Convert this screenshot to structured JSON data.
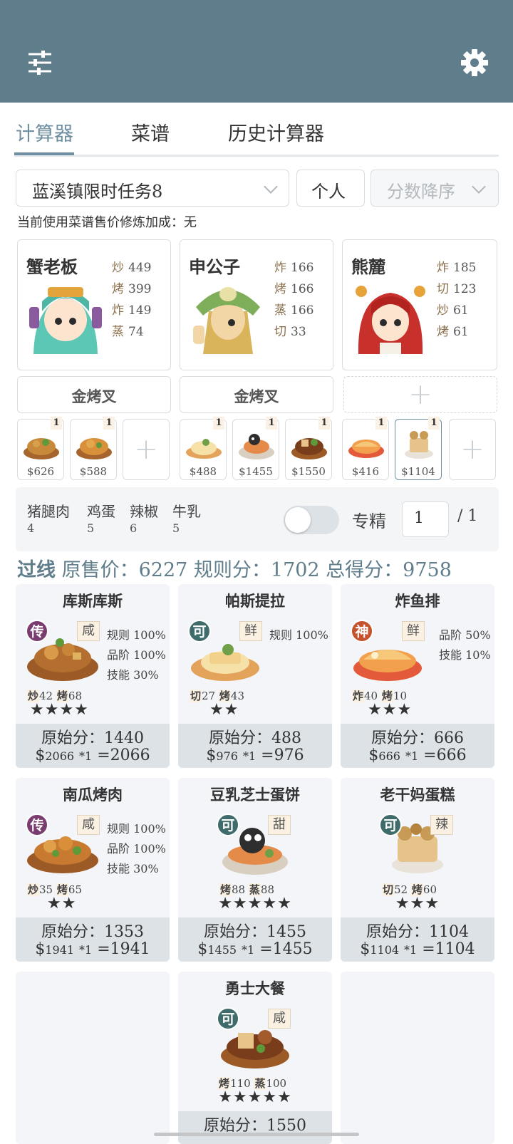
{
  "tabs": [
    "计算器",
    "菜谱",
    "历史计算器"
  ],
  "controls": {
    "task_select": "蓝溪镇限时任务8",
    "personal_button": "个人",
    "sort_select": "分数降序"
  },
  "bonus_note": "当前使用菜谱售价修炼加成：无",
  "chefs": [
    {
      "name": "蟹老板",
      "skills": [
        {
          "k": "炒",
          "v": "449"
        },
        {
          "k": "烤",
          "v": "399"
        },
        {
          "k": "炸",
          "v": "149"
        },
        {
          "k": "蒸",
          "v": "74"
        }
      ]
    },
    {
      "name": "申公子",
      "skills": [
        {
          "k": "炸",
          "v": "166"
        },
        {
          "k": "烤",
          "v": "166"
        },
        {
          "k": "蒸",
          "v": "166"
        },
        {
          "k": "切",
          "v": "33"
        }
      ]
    },
    {
      "name": "熊麓",
      "skills": [
        {
          "k": "炸",
          "v": "185"
        },
        {
          "k": "切",
          "v": "123"
        },
        {
          "k": "炒",
          "v": "61"
        },
        {
          "k": "烤",
          "v": "61"
        }
      ]
    }
  ],
  "equips": [
    "金烤叉",
    "金烤叉"
  ],
  "mini_dishes": [
    {
      "qty": "1",
      "price": "$626"
    },
    {
      "qty": "1",
      "price": "$588"
    },
    {
      "qty": "1",
      "price": "$488"
    },
    {
      "qty": "1",
      "price": "$1455"
    },
    {
      "qty": "1",
      "price": "$1550"
    },
    {
      "qty": "1",
      "price": "$416"
    },
    {
      "qty": "1",
      "price": "$1104"
    }
  ],
  "ingredients": [
    {
      "name": "猪腿肉",
      "count": "4"
    },
    {
      "name": "鸡蛋",
      "count": "5"
    },
    {
      "name": "辣椒",
      "count": "6"
    },
    {
      "name": "牛乳",
      "count": "5"
    }
  ],
  "special": {
    "label": "专精",
    "value": "1",
    "total": "/ 1"
  },
  "summary": {
    "status": "过线",
    "text": "原售价：6227 规则分：1702 总得分：9758"
  },
  "dishes": [
    {
      "name": "库斯库斯",
      "rank": "传",
      "flavor": "咸",
      "rules": [
        "规则 100%",
        "品阶 100%",
        "技能 30%"
      ],
      "req": [
        {
          "k": "炒",
          "v": "42"
        },
        {
          "k": "烤",
          "v": "68"
        }
      ],
      "stars": "★★★★",
      "orig": "原始分：1440",
      "price": "2066",
      "mult": "*1",
      "total": "=2066"
    },
    {
      "name": "帕斯提拉",
      "rank": "可",
      "flavor": "鲜",
      "rules": [
        "规则 100%"
      ],
      "req": [
        {
          "k": "切",
          "v": "27"
        },
        {
          "k": "烤",
          "v": "43"
        }
      ],
      "stars": "★★",
      "orig": "原始分：488",
      "price": "976",
      "mult": "*1",
      "total": "=976"
    },
    {
      "name": "炸鱼排",
      "rank": "神",
      "flavor": "鲜",
      "rules": [
        "品阶 50%",
        "技能 10%"
      ],
      "req": [
        {
          "k": "炸",
          "v": "40"
        },
        {
          "k": "烤",
          "v": "10"
        }
      ],
      "stars": "★★★",
      "orig": "原始分：666",
      "price": "666",
      "mult": "*1",
      "total": "=666"
    },
    {
      "name": "南瓜烤肉",
      "rank": "传",
      "flavor": "咸",
      "rules": [
        "规则 100%",
        "品阶 100%",
        "技能 30%"
      ],
      "req": [
        {
          "k": "炒",
          "v": "35"
        },
        {
          "k": "烤",
          "v": "65"
        }
      ],
      "stars": "★★",
      "orig": "原始分：1353",
      "price": "1941",
      "mult": "*1",
      "total": "=1941"
    },
    {
      "name": "豆乳芝士蛋饼",
      "rank": "可",
      "flavor": "甜",
      "rules": [],
      "req": [
        {
          "k": "烤",
          "v": "88"
        },
        {
          "k": "蒸",
          "v": "88"
        }
      ],
      "stars": "★★★★★",
      "orig": "原始分：1455",
      "price": "1455",
      "mult": "*1",
      "total": "=1455"
    },
    {
      "name": "老干妈蛋糕",
      "rank": "可",
      "flavor": "辣",
      "rules": [],
      "req": [
        {
          "k": "切",
          "v": "52"
        },
        {
          "k": "烤",
          "v": "60"
        }
      ],
      "stars": "★★★",
      "orig": "原始分：1104",
      "price": "1104",
      "mult": "*1",
      "total": "=1104"
    },
    {
      "name": "勇士大餐",
      "rank": "可",
      "flavor": "咸",
      "rules": [],
      "req": [
        {
          "k": "烤",
          "v": "110"
        },
        {
          "k": "蒸",
          "v": "100"
        }
      ],
      "stars": "★★★★★",
      "orig": "原始分：1550",
      "price": "",
      "mult": "",
      "total": ""
    }
  ],
  "colors": {
    "header": "#5f7d8a",
    "accent": "#6f8fa0",
    "rank_legend": "#7a3b6e",
    "rank_ok": "#3f6b6b",
    "rank_god": "#c4532e"
  }
}
